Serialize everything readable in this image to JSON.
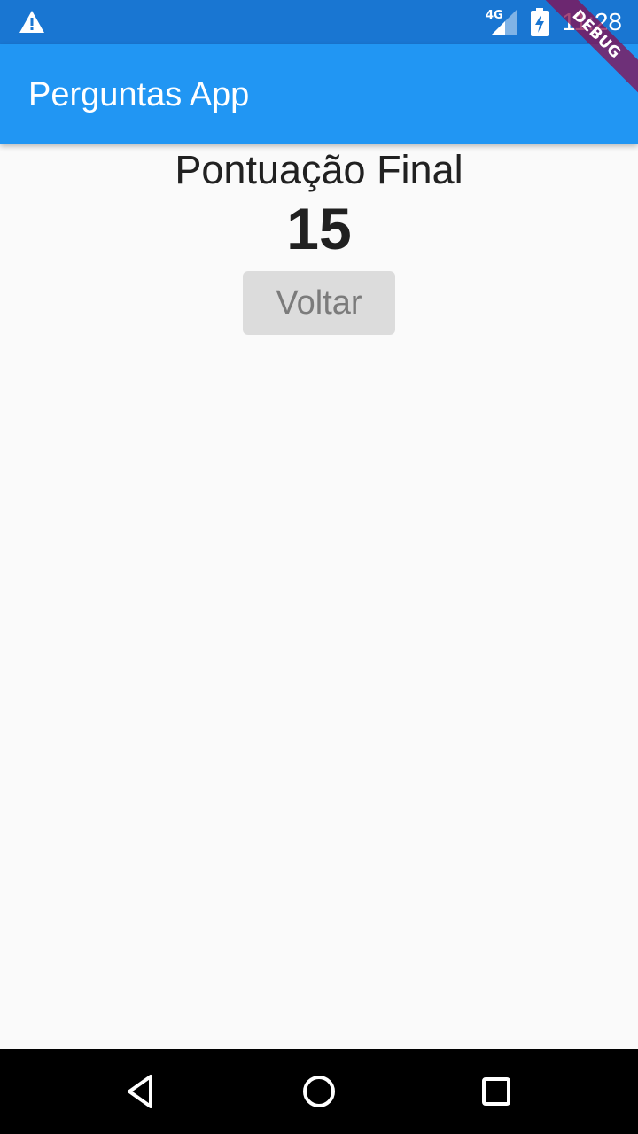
{
  "status_bar": {
    "network_label": "4G",
    "time": "11:28",
    "icons": [
      "warning-icon",
      "signal-icon",
      "battery-charging-icon"
    ]
  },
  "debug_banner": "DEBUG",
  "app_bar": {
    "title": "Perguntas App",
    "color": "#2196f3"
  },
  "result": {
    "label": "Pontuação Final",
    "score": "15"
  },
  "actions": {
    "back_label": "Voltar"
  },
  "navigation": {
    "icons": [
      "back-triangle-icon",
      "home-circle-icon",
      "recents-square-icon"
    ]
  }
}
